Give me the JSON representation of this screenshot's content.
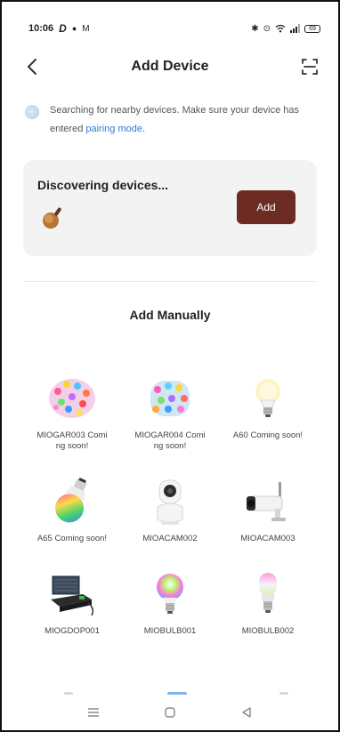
{
  "status_bar": {
    "time": "10:06",
    "left_icons": [
      "d-app-icon",
      "dot-icon",
      "mail-icon"
    ],
    "right_icons": [
      "bluetooth-icon",
      "location-icon",
      "wifi-icon",
      "signal-icon"
    ],
    "battery": "69"
  },
  "header": {
    "title": "Add Device",
    "back_icon": "chevron-left-icon",
    "scan_icon": "scan-icon"
  },
  "notice": {
    "text": "Searching for nearby devices. Make sure your device has entered ",
    "link": "pairing mode",
    "suffix": "."
  },
  "discover": {
    "title": "Discovering devices...",
    "add_label": "Add",
    "accent": "#6d2c23"
  },
  "manual": {
    "title": "Add Manually",
    "devices": [
      {
        "label": "MIOGAR003 Coming soon!",
        "icon": "string-lights-icon"
      },
      {
        "label": "MIOGAR004 Coming soon!",
        "icon": "string-lights-icon"
      },
      {
        "label": "A60 Coming soon!",
        "icon": "bulb-icon"
      },
      {
        "label": "A65 Coming soon!",
        "icon": "rgb-bulb-icon"
      },
      {
        "label": "MIOACAM002",
        "icon": "indoor-camera-icon"
      },
      {
        "label": "MIOACAM003",
        "icon": "outdoor-camera-icon"
      },
      {
        "label": "MIOGDOP001",
        "icon": "garage-controller-icon"
      },
      {
        "label": "MIOBULB001",
        "icon": "rgb-bulb-icon"
      },
      {
        "label": "MIOBULB002",
        "icon": "rgb-bulb-icon"
      }
    ]
  },
  "nav_bar": {
    "icons": [
      "menu-icon",
      "home-icon",
      "back-triangle-icon"
    ]
  }
}
